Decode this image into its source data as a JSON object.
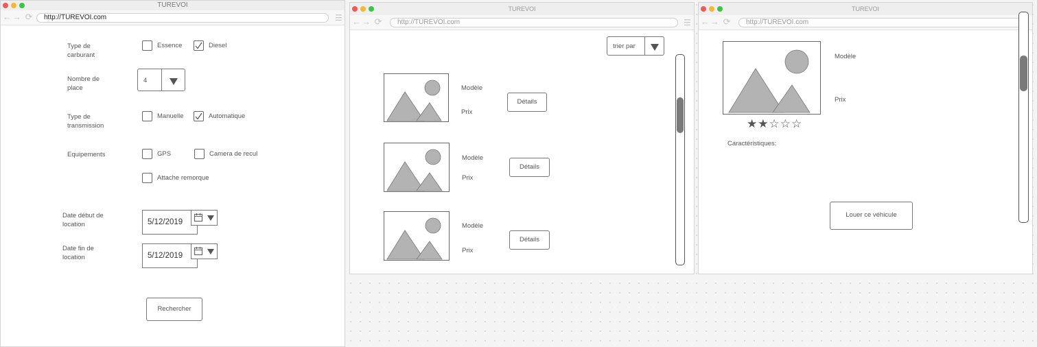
{
  "window1": {
    "title": "TUREVOI",
    "url": "http://TUREVOI.com",
    "form": {
      "fuel_label": "Type de carburant",
      "fuel_options": [
        {
          "label": "Essence",
          "checked": false
        },
        {
          "label": "Diesel",
          "checked": true
        }
      ],
      "seats_label": "Nombre de place",
      "seats_value": "4",
      "transmission_label": "Type de transmission",
      "transmission_options": [
        {
          "label": "Manuelle",
          "checked": false
        },
        {
          "label": "Automatique",
          "checked": true
        }
      ],
      "equipment_label": "Equipements",
      "equipment_options": [
        {
          "label": "GPS",
          "checked": false
        },
        {
          "label": "Camera de recul",
          "checked": false
        },
        {
          "label": "Attache remorque",
          "checked": false
        }
      ],
      "start_date_label": "Date début de location",
      "start_date_value": "5/12/2019",
      "end_date_label": "Date fin de location",
      "end_date_value": "5/12/2019",
      "search_button": "Rechercher"
    }
  },
  "window2": {
    "title": "TUREVOI",
    "url": "http://TUREVOI.com",
    "sort_label": "trier par",
    "results": [
      {
        "model_label": "Modèle",
        "price_label": "Prix",
        "details_button": "Détails"
      },
      {
        "model_label": "Modèle",
        "price_label": "Prix",
        "details_button": "Détails"
      },
      {
        "model_label": "Modèle",
        "price_label": "Prix",
        "details_button": "Détails"
      }
    ],
    "scroll_position": 0.25
  },
  "window3": {
    "title": "TUREVOI",
    "url": "http://TUREVOI.com",
    "model_label": "Modèle",
    "price_label": "Prix",
    "rating": 2,
    "rating_max": 5,
    "characteristics_label": "Caractéristiques:",
    "rent_button": "Louer ce véhicule",
    "scroll_position": 0.2
  },
  "colors": {
    "dot_red": "#ee5b56",
    "dot_yellow": "#f5b837",
    "dot_green": "#3ec24a",
    "placeholder_shape": "#b3b3b3"
  },
  "icons": [
    "back-arrow-icon",
    "forward-arrow-icon",
    "reload-icon",
    "menu-icon",
    "checkmark-icon",
    "chevron-down-icon",
    "calendar-icon",
    "image-placeholder-icon",
    "star-icon"
  ]
}
